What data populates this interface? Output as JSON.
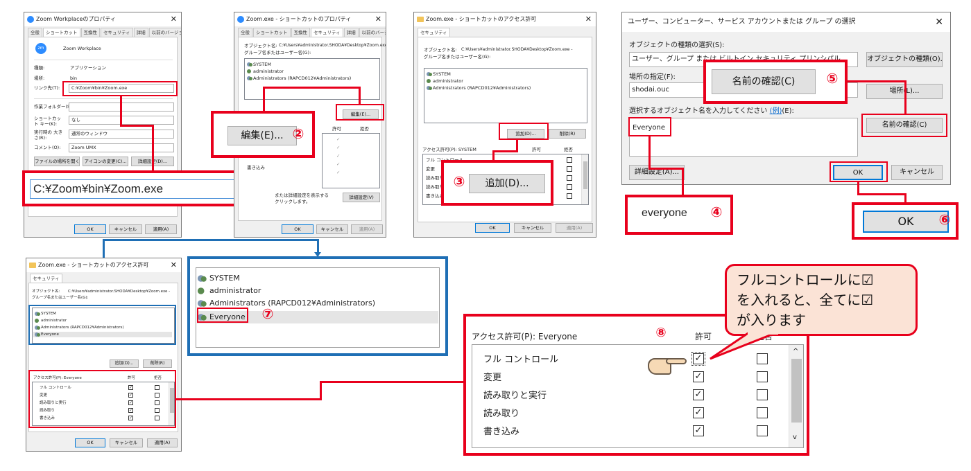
{
  "w1": {
    "title": "Zoom Workplaceのプロパティ",
    "close": "✕",
    "tabs": [
      "全般",
      "ショートカット",
      "互換性",
      "セキュリティ",
      "詳細",
      "以前のバージョン"
    ],
    "app_name": "Zoom Workplace",
    "rows": [
      {
        "label": "種類:",
        "value": "アプリケーション"
      },
      {
        "label": "場所:",
        "value": "bin"
      }
    ],
    "link_label": "リンク先(T):",
    "link_value": "C:¥Zoom¥bin¥Zoom.exe",
    "workdir_label": "作業フォルダー(S):",
    "shortcut_label": "ショートカット キー(K):",
    "shortcut_value": "なし",
    "size_label": "実行時の 大きさ(R):",
    "size_value": "通常のウィンドウ",
    "comment_label": "コメント(O):",
    "comment_value": "Zoom UMX",
    "btn_open": "ファイルの場所を開く(F)",
    "btn_icon": "アイコンの変更(C)...",
    "btn_adv": "詳細設定(D)...",
    "ok": "OK",
    "cancel": "キャンセル",
    "apply": "適用(A)"
  },
  "callout1": {
    "num": "①",
    "text": "C:¥Zoom¥bin¥Zoom.exe"
  },
  "w2": {
    "title": "Zoom.exe - ショートカットのプロパティ",
    "close": "✕",
    "tabs": [
      "全般",
      "ショートカット",
      "互換性",
      "セキュリティ",
      "詳細",
      "以前のバージョン"
    ],
    "obj_label": "オブジェクト名:",
    "obj_value": "C:¥Users¥administrator.SHODA¥Desktop¥Zoom.exe -",
    "group_label": "グループ名またはユーザー名(G):",
    "users": [
      "SYSTEM",
      "administrator",
      "Administrators (RAPCD012¥Administrators)"
    ],
    "edit": "編集(E)...",
    "allow": "許可",
    "deny": "拒否",
    "perms": [
      "書き込み"
    ],
    "adv_text1": "または詳細設定を表示する",
    "adv_text2": "クリックします。",
    "adv_btn": "詳細設定(V)",
    "ok": "OK",
    "cancel": "キャンセル",
    "apply": "適用(A)"
  },
  "callout2": {
    "num": "②",
    "text": "編集(E)..."
  },
  "w3": {
    "title": "Zoom.exe - ショートカットのアクセス許可",
    "close": "✕",
    "tab": "セキュリティ",
    "obj_label": "オブジェクト名:",
    "obj_value": "C:¥Users¥administrator.SHODA¥Desktop¥Zoom.exe -",
    "group_label": "グループ名またはユーザー名(G):",
    "users": [
      "SYSTEM",
      "administrator",
      "Administrators (RAPCD012¥Administrators)"
    ],
    "add": "追加(D)...",
    "remove": "削除(R)",
    "perm_label": "アクセス許可(P): SYSTEM",
    "allow": "許可",
    "deny": "拒否",
    "perms": [
      "フル コントロール",
      "変更",
      "読み取り",
      "読み取り",
      "書き込み"
    ],
    "ok": "OK",
    "cancel": "キャンセル",
    "apply": "適用(A)"
  },
  "callout3": {
    "num": "③",
    "text": "追加(D)..."
  },
  "w4": {
    "title": "ユーザー、コンピューター、サービス アカウントまたは グループ の選択",
    "close": "✕",
    "type_label": "オブジェクトの種類の選択(S):",
    "type_value": "ユーザー、グループ または ビルトイン セキュリティ プリンシパル",
    "type_btn": "オブジェクトの種類(O)...",
    "loc_label": "場所の指定(F):",
    "loc_value": "shodai.ouc",
    "loc_btn": "場所(L)...",
    "name_label": "選択するオブジェクト名を入力してください",
    "name_link": "(例)",
    "name_label2": "(E):",
    "name_value": "Everyone",
    "check_btn": "名前の確認(C)",
    "adv": "詳細設定(A)...",
    "ok": "OK",
    "cancel": "キャンセル"
  },
  "callout4": {
    "num": "④",
    "text": "everyone"
  },
  "callout5": {
    "num": "⑤",
    "text": "名前の確認(C)"
  },
  "callout6": {
    "num": "⑥",
    "text": "OK"
  },
  "w5": {
    "title": "Zoom.exe - ショートカットのアクセス許可",
    "close": "✕",
    "tab": "セキュリティ",
    "obj_label": "オブジェクト名:",
    "obj_value": "C:¥Users¥administrator.SHODA¥Desktop¥Zoom.exe -",
    "group_label": "グループ名またはユーザー名(G):",
    "users": [
      "SYSTEM",
      "administrator",
      "Administrators (RAPCD012¥Administrators)",
      "Everyone"
    ],
    "add": "追加(D)...",
    "remove": "削除(R)",
    "perm_label": "アクセス許可(P): Everyone",
    "allow": "許可",
    "deny": "拒否",
    "perms": [
      "フル コントロール",
      "変更",
      "読み取りと実行",
      "読み取り",
      "書き込み"
    ],
    "ok": "OK",
    "cancel": "キャンセル",
    "apply": "適用(A)"
  },
  "zoom7": {
    "users": [
      "SYSTEM",
      "administrator",
      "Administrators (RAPCD012¥Administrators)",
      "Everyone"
    ],
    "num": "⑦"
  },
  "zoom8": {
    "perm_label": "アクセス許可(P): Everyone",
    "allow": "許可",
    "deny": "拒否",
    "num": "⑧",
    "perms": [
      "フル コントロール",
      "変更",
      "読み取りと実行",
      "読み取り",
      "書き込み"
    ],
    "allow_checked": [
      true,
      true,
      true,
      true,
      true
    ],
    "deny_checked": [
      false,
      false,
      false,
      false,
      false
    ]
  },
  "note": {
    "line1": "フルコントロールに☑",
    "line2": "を入れると、全てに☑",
    "line3": "が入ります"
  },
  "colors": {
    "red": "#e8001c",
    "blue": "#1f6fb5",
    "note_bg": "#fbe3d6"
  }
}
